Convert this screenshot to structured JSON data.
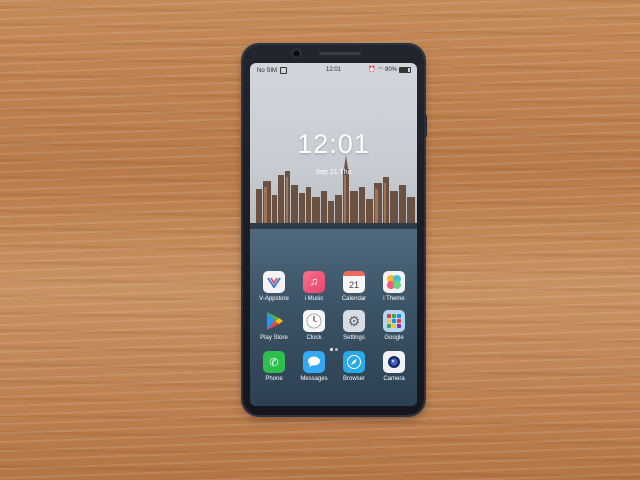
{
  "status_bar": {
    "carrier": "No SIM",
    "time": "12:01",
    "battery": "80%"
  },
  "lock_screen": {
    "time": "12:01",
    "date": "Sep 21 Thu"
  },
  "apps": [
    {
      "label": "V-Appstore",
      "icon": "v-appstore-icon",
      "color": "#f4f4f6"
    },
    {
      "label": "i Music",
      "icon": "music-icon",
      "color": "#f25a7c"
    },
    {
      "label": "Calendar",
      "icon": "calendar-icon",
      "color": "#f6f6f6",
      "day": "21"
    },
    {
      "label": "i Theme",
      "icon": "theme-icon",
      "color": "#f3f3f3"
    },
    {
      "label": "Play Store",
      "icon": "play-store-icon",
      "color": "rgba(0,0,0,0)"
    },
    {
      "label": "Clock",
      "icon": "clock-icon",
      "color": "#f6f6f6"
    },
    {
      "label": "Settings",
      "icon": "settings-icon",
      "color": "#d8dde2"
    },
    {
      "label": "Google",
      "icon": "google-folder-icon",
      "color": "#b4d6f0"
    }
  ],
  "dock": [
    {
      "label": "Phone",
      "icon": "phone-icon",
      "color": "#2fbf4e"
    },
    {
      "label": "Messages",
      "icon": "messages-icon",
      "color": "#34a9ef"
    },
    {
      "label": "Browser",
      "icon": "browser-icon",
      "color": "#29a9e8"
    },
    {
      "label": "Camera",
      "icon": "camera-icon",
      "color": "#f2f2f2"
    }
  ]
}
